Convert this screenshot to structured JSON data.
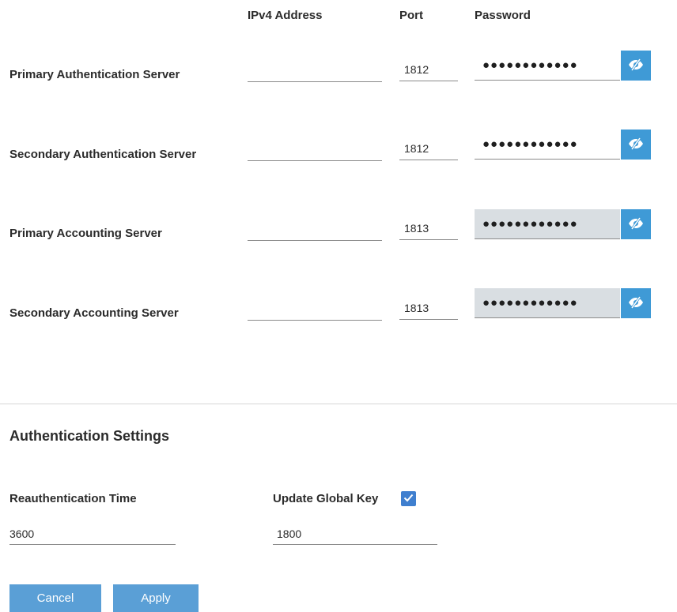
{
  "columns": {
    "ipv4": "IPv4 Address",
    "port": "Port",
    "password": "Password"
  },
  "servers": [
    {
      "label": "Primary Authentication Server",
      "ipv4": "",
      "port": "1812",
      "password_mask": "●●●●●●●●●●●●",
      "password_disabled": false
    },
    {
      "label": "Secondary Authentication Server",
      "ipv4": "",
      "port": "1812",
      "password_mask": "●●●●●●●●●●●●",
      "password_disabled": false
    },
    {
      "label": "Primary Accounting Server",
      "ipv4": "",
      "port": "1813",
      "password_mask": "●●●●●●●●●●●●",
      "password_disabled": true
    },
    {
      "label": "Secondary Accounting Server",
      "ipv4": "",
      "port": "1813",
      "password_mask": "●●●●●●●●●●●●",
      "password_disabled": true
    }
  ],
  "icons": {
    "toggle_visibility": "eye-slash-icon",
    "checkmark": "checkmark-icon"
  },
  "auth_settings": {
    "title": "Authentication Settings",
    "reauth_label": "Reauthentication Time",
    "reauth_value": "3600",
    "global_key_label": "Update Global Key",
    "global_key_checked": true,
    "global_key_value": "1800"
  },
  "buttons": {
    "cancel": "Cancel",
    "apply": "Apply"
  },
  "colors": {
    "accent": "#3f9ad6",
    "button": "#5a9fd6",
    "checkbox": "#3f7fcf",
    "disabled_field": "#d9dee2"
  }
}
